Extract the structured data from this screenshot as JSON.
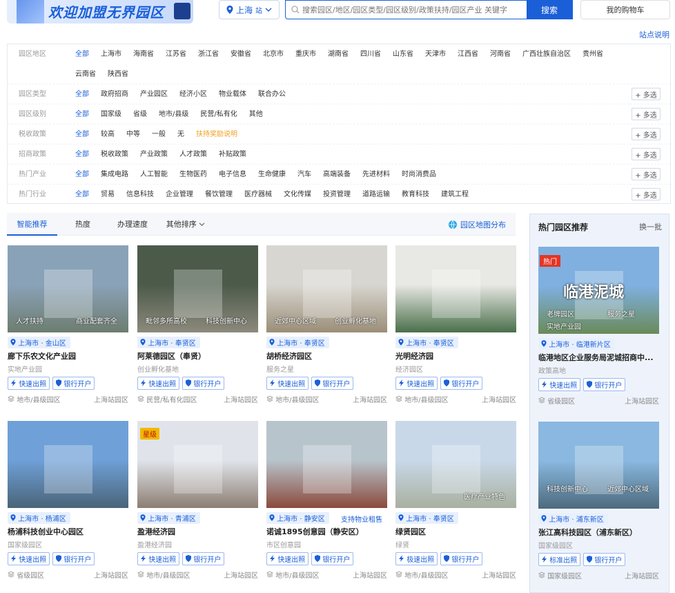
{
  "header": {
    "logo_text": "欢迎加盟无界园区",
    "city": "上海",
    "city_suffix": "站",
    "search_placeholder": "搜索园区/地区/园区类型/园区级别/政策扶持/园区产业 关键字",
    "search_button": "搜索",
    "cart": "我的购物车",
    "station_info": "站点说明"
  },
  "filters": [
    {
      "label": "园区地区",
      "options": [
        "全部",
        "上海市",
        "海南省",
        "江苏省",
        "浙江省",
        "安徽省",
        "北京市",
        "重庆市",
        "湖南省",
        "四川省",
        "山东省",
        "天津市",
        "江西省",
        "河南省",
        "广西壮族自治区",
        "贵州省",
        "云南省",
        "陕西省"
      ],
      "more": ""
    },
    {
      "label": "园区类型",
      "options": [
        "全部",
        "政府招商",
        "产业园区",
        "经济小区",
        "物业载体",
        "联合办公"
      ],
      "more": "+ 多选"
    },
    {
      "label": "园区级别",
      "options": [
        "全部",
        "国家级",
        "省级",
        "地市/县级",
        "民营/私有化",
        "其他"
      ],
      "more": "+ 多选"
    },
    {
      "label": "税收政策",
      "options": [
        "全部",
        "较高",
        "中等",
        "一般",
        "无",
        "扶持奖励说明"
      ],
      "more": "+ 多选"
    },
    {
      "label": "招商政策",
      "options": [
        "全部",
        "税收政策",
        "产业政策",
        "人才政策",
        "补贴政策"
      ],
      "more": "+ 多选"
    },
    {
      "label": "热门产业",
      "options": [
        "全部",
        "集成电路",
        "人工智能",
        "生物医药",
        "电子信息",
        "生命健康",
        "汽车",
        "高端装备",
        "先进材料",
        "时尚消费品"
      ],
      "more": "+ 多选"
    },
    {
      "label": "热门行业",
      "options": [
        "全部",
        "贸易",
        "信息科技",
        "企业管理",
        "餐饮管理",
        "医疗器械",
        "文化传媒",
        "投资管理",
        "道路运输",
        "教育科技",
        "建筑工程"
      ],
      "more": "+ 多选"
    }
  ],
  "tabs": [
    "智能推荐",
    "热度",
    "办理速度",
    "其他排序"
  ],
  "map_link": "园区地图分布",
  "cards": [
    {
      "caption_left": "人才扶持",
      "caption_right": "商业配套齐全",
      "location": "上海市 · 金山区",
      "name": "廊下乐农文化产业园",
      "sub": "实地产业园",
      "tag1": "快速出照",
      "tag2": "银行开户",
      "level": "地市/县级园区",
      "station": "上海站园区",
      "colors": [
        "#8aa2b8",
        "#6d7d70"
      ]
    },
    {
      "caption_left": "毗邻多所高校",
      "caption_right": "科技创新中心",
      "location": "上海市 · 奉贤区",
      "name": "阿莱德园区（奉贤）",
      "sub": "创业孵化基地",
      "tag1": "快速出照",
      "tag2": "银行开户",
      "level": "民营/私有化园区",
      "station": "上海站园区",
      "colors": [
        "#4c5a4a",
        "#8c8a7c"
      ]
    },
    {
      "caption_left": "近郊中心区域",
      "caption_right": "创业孵化基地",
      "location": "上海市 · 奉贤区",
      "name": "胡桥经济园区",
      "sub": "服务之星",
      "tag1": "快速出照",
      "tag2": "银行开户",
      "level": "地市/县级园区",
      "station": "上海站园区",
      "colors": [
        "#d8d6d0",
        "#9b8e78"
      ]
    },
    {
      "caption_left": "",
      "caption_right": "",
      "location": "上海市 · 奉贤区",
      "name": "光明经济园",
      "sub": "经济园区",
      "tag1": "快速出照",
      "tag2": "银行开户",
      "level": "地市/县级园区",
      "station": "上海站园区",
      "colors": [
        "#e8e8e4",
        "#4a6f4a"
      ]
    },
    {
      "caption_left": "",
      "caption_right": "",
      "location": "上海市 · 杨浦区",
      "name": "杨浦科技创业中心园区",
      "sub": "国家级园区",
      "tag1": "快速出照",
      "tag2": "银行开户",
      "level": "省级园区",
      "station": "上海站园区",
      "colors": [
        "#6fa0d8",
        "#4a6478"
      ]
    },
    {
      "caption_left": "",
      "caption_right": "",
      "badge": "星级",
      "location": "上海市 · 青浦区",
      "name": "盈港经济园",
      "sub": "盈港经济园",
      "tag1": "快速出照",
      "tag2": "银行开户",
      "level": "地市/县级园区",
      "station": "上海站园区",
      "colors": [
        "#e0e4ea",
        "#8c7e72"
      ]
    },
    {
      "caption_left": "",
      "caption_right": "",
      "extra": "支持物业租售",
      "location": "上海市 · 静安区",
      "name": "诺诚1895创意园（静安区）",
      "sub": "市区创意园",
      "tag1": "快速出照",
      "tag2": "银行开户",
      "level": "地市/县级园区",
      "station": "上海站园区",
      "colors": [
        "#b8c4cc",
        "#8a4a3c"
      ]
    },
    {
      "caption_left": "",
      "caption_right": "医疗产业特色",
      "location": "上海市 · 奉贤区",
      "name": "绿贤园区",
      "sub": "绿贤",
      "tag1": "极速出照",
      "tag2": "银行开户",
      "level": "地市/县级园区",
      "station": "上海站园区",
      "colors": [
        "#c8d8e8",
        "#a8b0a0"
      ]
    }
  ],
  "side": {
    "title": "热门园区推荐",
    "change": "换一批",
    "items": [
      {
        "hot": "热门",
        "img_title": "临港泥城",
        "caption1": "老牌园区",
        "caption2": "服务之星",
        "caption3": "实地产业园",
        "location": "上海市 · 临港新片区",
        "name": "临港地区企业服务局泥城招商中...",
        "sub": "政策高地",
        "tag1": "快速出照",
        "tag2": "银行开户",
        "level": "省级园区",
        "station": "上海站园区",
        "colors": [
          "#7fb0e0",
          "#6a8a5a"
        ]
      },
      {
        "hot": "",
        "img_title": "",
        "caption1": "科技创新中心",
        "caption2": "近郊中心区域",
        "caption3": "",
        "location": "上海市 · 浦东新区",
        "name": "张江高科技园区（浦东新区）",
        "sub": "国家级园区",
        "tag1": "标准出照",
        "tag2": "银行开户",
        "level": "国家级园区",
        "station": "上海站园区",
        "colors": [
          "#8ab8e0",
          "#4c6a7c"
        ]
      }
    ]
  }
}
